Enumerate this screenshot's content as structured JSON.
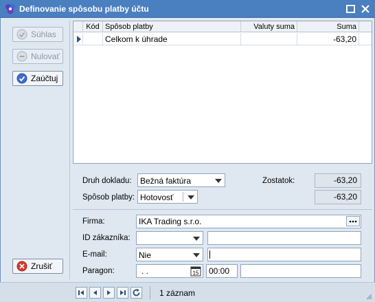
{
  "window": {
    "title": "Definovanie spôsobu platby účtu",
    "accent": "#4a7fc0"
  },
  "sidebar": {
    "approve_label": "Súhlas",
    "reset_label": "Nulovať",
    "post_label": "Zaúčtuj",
    "cancel_label": "Zrušiť"
  },
  "grid": {
    "columns": [
      "Kód",
      "Spôsob platby",
      "Valuty suma",
      "Suma"
    ],
    "rows": [
      {
        "code": "",
        "method": "Celkom k úhrade",
        "currency_amount": "",
        "amount": "-63,20"
      }
    ]
  },
  "form": {
    "doc_type_label": "Druh dokladu:",
    "doc_type_value": "Bežná faktúra",
    "payment_method_label": "Spôsob platby:",
    "payment_method_value": "Hotovosť",
    "balance_label": "Zostatok:",
    "balance_value": "-63,20",
    "payment_amount_value": "-63,20",
    "company_label": "Firma:",
    "company_value": "IKA Trading s.r.o.",
    "customer_id_label": "ID zákazníka:",
    "customer_id_value": "",
    "customer_name_value": "",
    "email_label": "E-mail:",
    "email_choice": "Nie",
    "email_value": "",
    "receipt_label": "Paragon:",
    "receipt_date": ". .",
    "receipt_time": "00:00",
    "receipt_number": ""
  },
  "navigator": {
    "record_count": "1 záznam"
  }
}
